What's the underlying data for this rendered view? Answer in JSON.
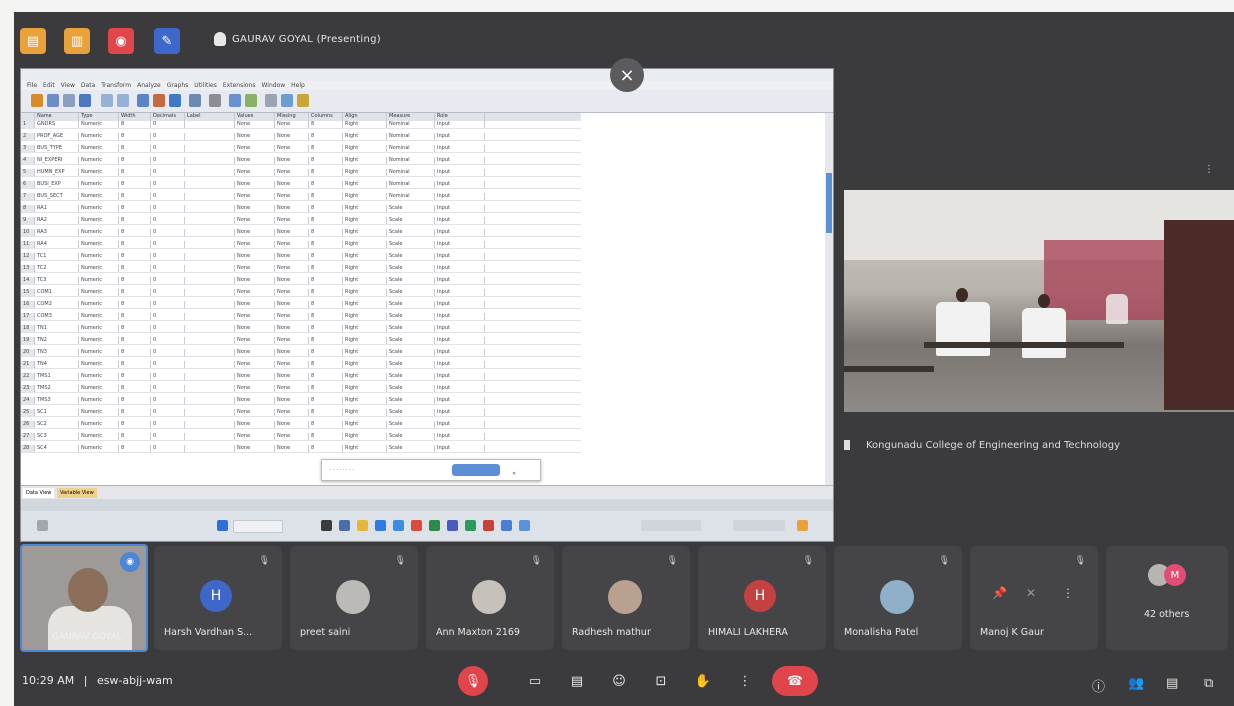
{
  "meet": {
    "presenter_label": "GAURAV GOYAL (Presenting)",
    "top_icons": [
      "file-icon",
      "notes-icon",
      "record-icon",
      "pin-icon"
    ],
    "colors": {
      "accent": "#4d86d6",
      "danger": "#e0454b",
      "orange": "#e9a13a"
    }
  },
  "room": {
    "label": "Kongunadu College of Engineering and Technology"
  },
  "participants": [
    {
      "name": "Harsh Vardhan S...",
      "avatar": "H",
      "color": "#3d68c9"
    },
    {
      "name": "preet saini",
      "avatar": "photo"
    },
    {
      "name": "Ann Maxton 2169",
      "avatar": "photo"
    },
    {
      "name": "Radhesh mathur",
      "avatar": "photo"
    },
    {
      "name": "HIMALI LAKHERA",
      "avatar": "H",
      "color": "#c44142"
    },
    {
      "name": "Monalisha Patel",
      "avatar": "photo"
    },
    {
      "name": "Manoj K Gaur",
      "avatar": "muted"
    },
    {
      "name": "42 others",
      "avatar": "group"
    }
  ],
  "self": {
    "name": "GAURAV GOYAL"
  },
  "bottom": {
    "time": "10:29 AM",
    "separator": "|",
    "meeting_code": "esw-abjj-wam"
  },
  "spreadsheet": {
    "columns": [
      "Name",
      "Type",
      "Width",
      "Decimals",
      "Label",
      "Values",
      "Missing",
      "Columns",
      "Align",
      "Measure",
      "Role"
    ],
    "names": [
      "GNDRS",
      "PROF_AGE",
      "BUS_TYPE",
      "NI_EXPERI",
      "HUMN_EXP",
      "BUSI_EXP",
      "BUS_SECT",
      "RA1",
      "RA2",
      "RA3",
      "RA4",
      "TC1",
      "TC2",
      "TC3",
      "COM1",
      "COM2",
      "COM3",
      "TN1",
      "TN2",
      "TN3",
      "TN4",
      "TMS1",
      "TMS2",
      "TMS3",
      "SC1",
      "SC2",
      "SC3",
      "SC4"
    ],
    "type_value": "Numeric",
    "width_value": "8",
    "decimals_value": "0",
    "values_value": "None",
    "missing_value": "None",
    "columns_value": "8",
    "align_value": "Right",
    "measure_values": [
      "Nominal",
      "Nominal",
      "Nominal",
      "Nominal",
      "Nominal",
      "Nominal",
      "Nominal",
      "Scale",
      "Scale",
      "Scale",
      "Scale",
      "Scale",
      "Scale",
      "Scale",
      "Scale",
      "Scale",
      "Scale",
      "Scale",
      "Scale",
      "Scale",
      "Scale",
      "Scale",
      "Scale",
      "Scale",
      "Scale",
      "Scale",
      "Scale",
      "Scale"
    ],
    "role_value": "Input",
    "tabs": [
      "Data View",
      "Variable View"
    ]
  }
}
